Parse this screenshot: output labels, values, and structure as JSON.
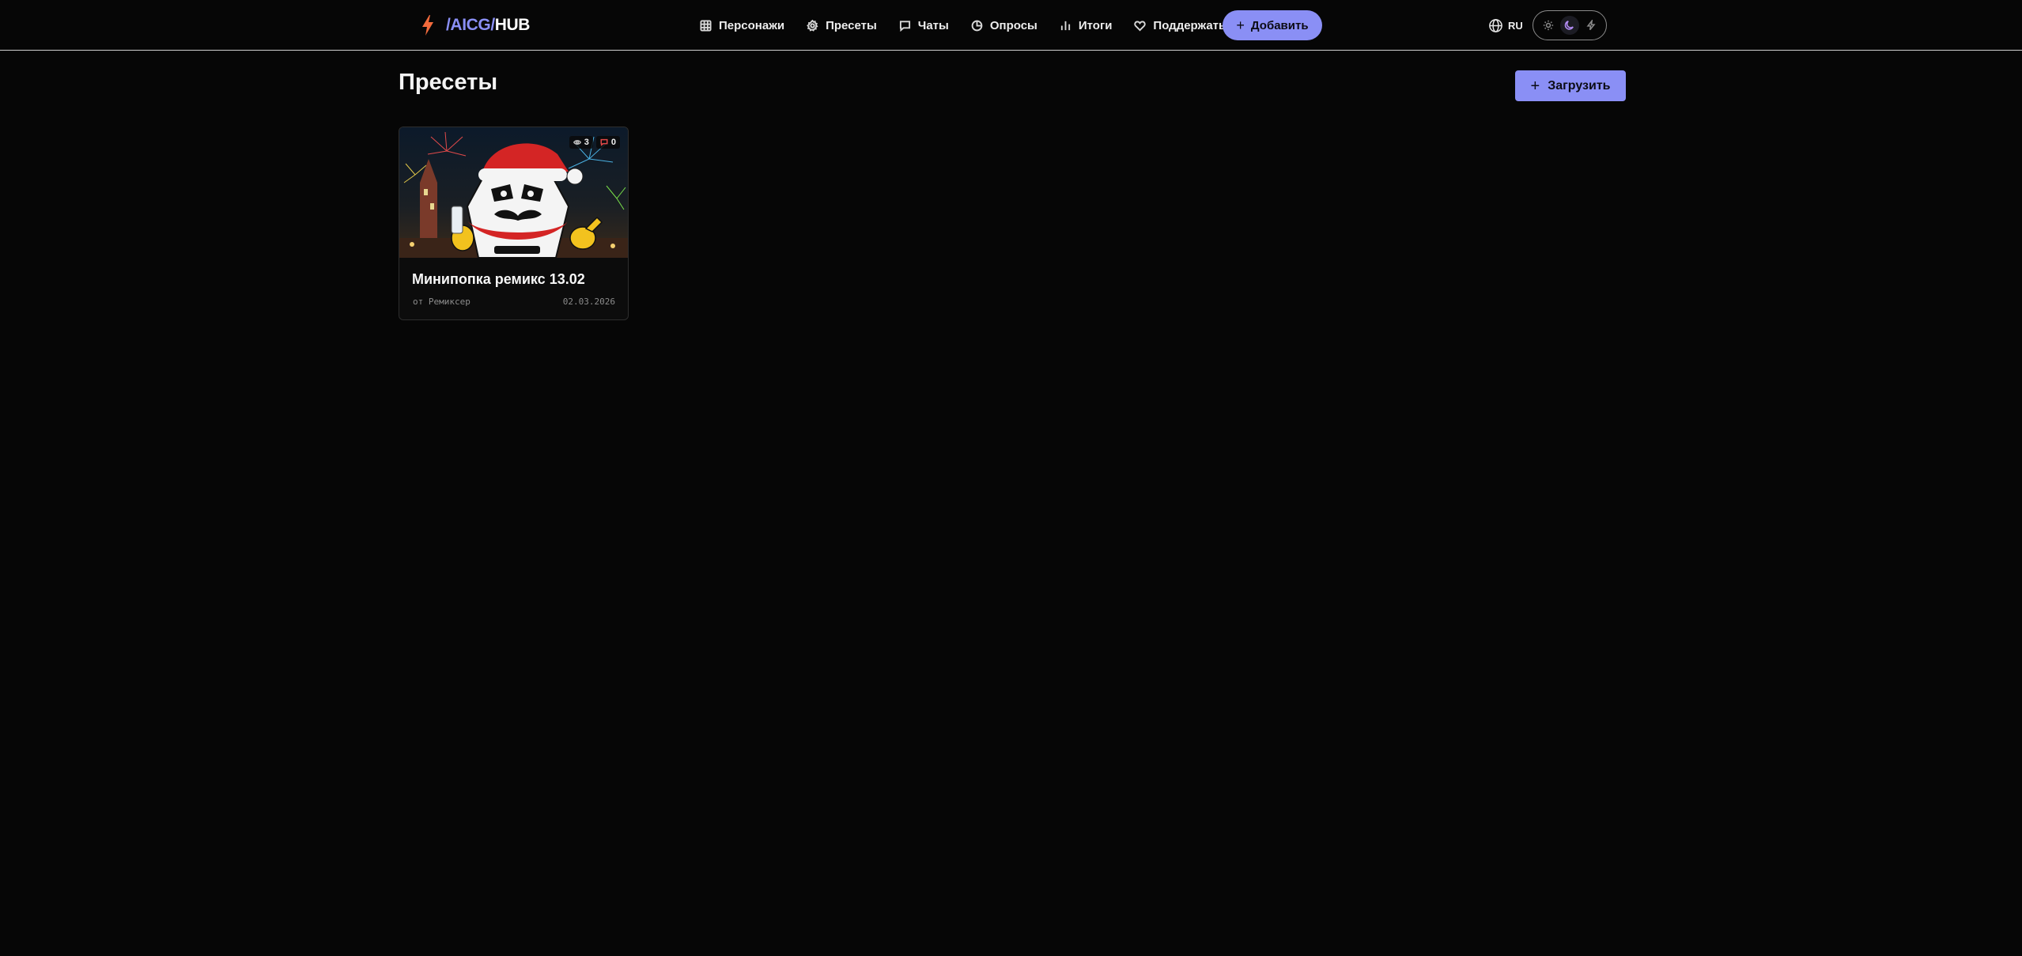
{
  "header": {
    "logo": {
      "prefix": "/AICG/",
      "suffix": "HUB",
      "icon": "lightning-icon"
    },
    "nav": [
      {
        "label": "Персонажи",
        "icon": "grid-icon"
      },
      {
        "label": "Пресеты",
        "icon": "gear-icon"
      },
      {
        "label": "Чаты",
        "icon": "chat-bubble-icon"
      },
      {
        "label": "Опросы",
        "icon": "pie-chart-icon"
      },
      {
        "label": "Итоги",
        "icon": "bar-chart-icon"
      },
      {
        "label": "Поддержать",
        "icon": "heart-icon"
      }
    ],
    "add_button": {
      "label": "Добавить",
      "icon": "plus-icon"
    },
    "language": {
      "label": "RU",
      "icon": "globe-icon"
    },
    "theme_switch": {
      "options": [
        "light",
        "dark",
        "accent"
      ],
      "active": "dark"
    }
  },
  "page": {
    "title": "Пресеты",
    "upload_button": {
      "label": "Загрузить",
      "icon": "plus-icon"
    }
  },
  "presets": [
    {
      "title": "Минипопка ремикс 13.02",
      "author": "от Ремиксер",
      "date": "02.03.2026",
      "views": "3",
      "comments": "0"
    }
  ],
  "colors": {
    "accent": "#8a8ff5",
    "background": "#060606",
    "logo_icon": "#f26a3c"
  }
}
